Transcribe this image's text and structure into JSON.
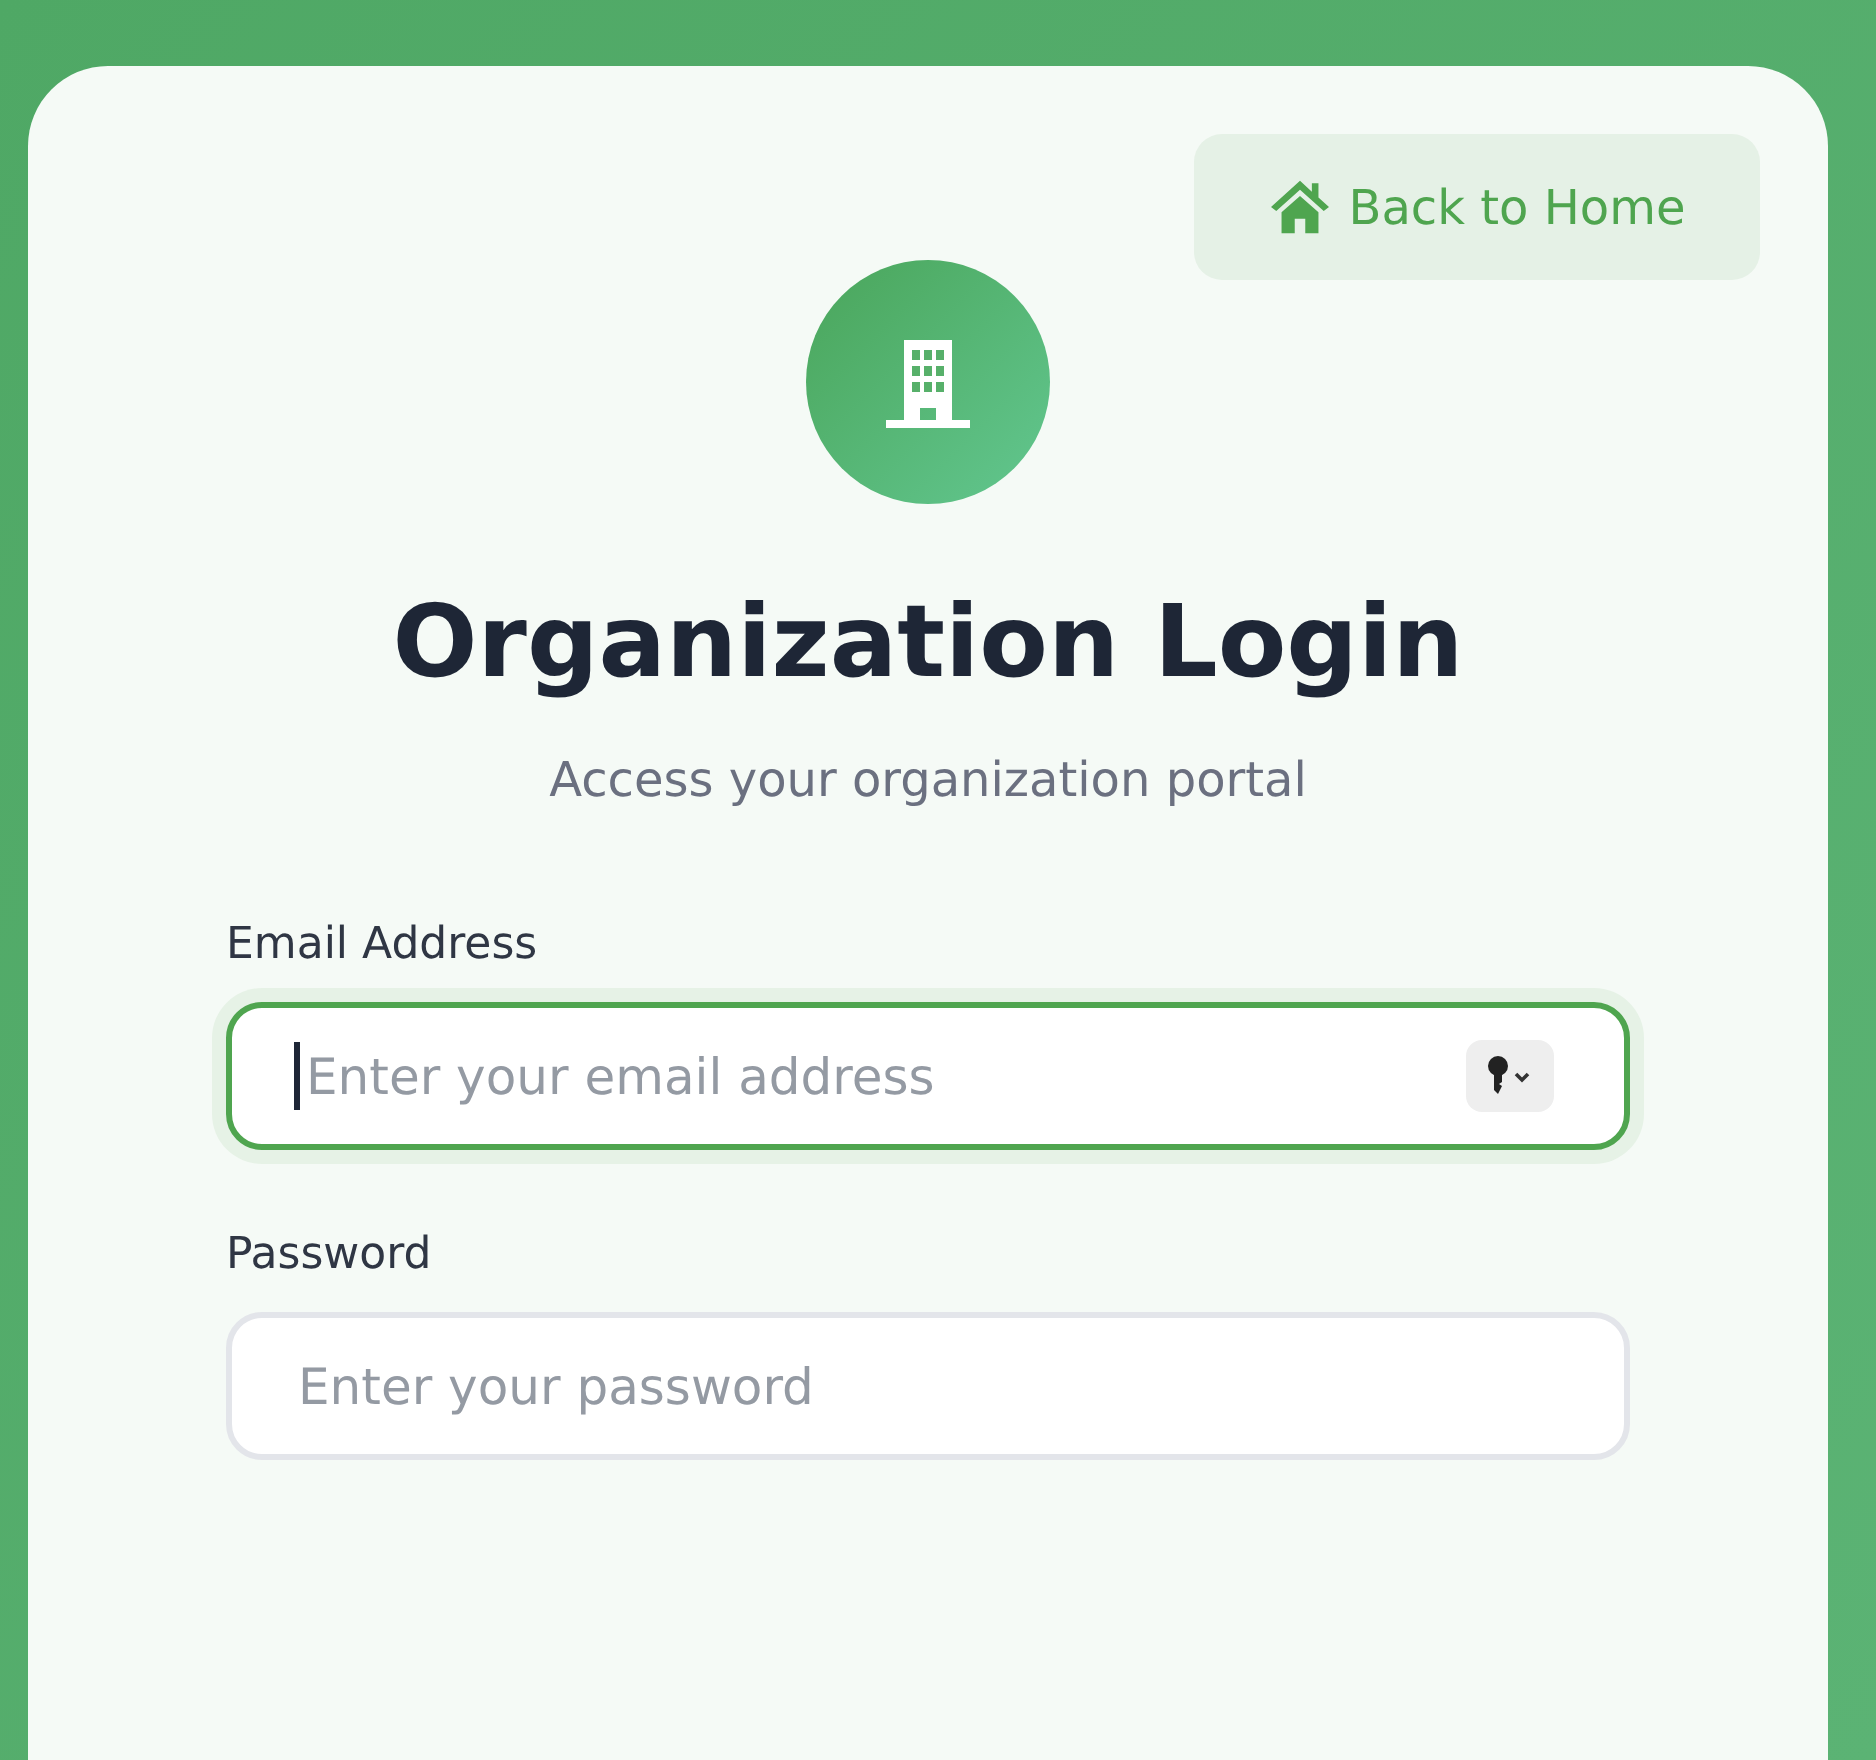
{
  "back_button": {
    "label": "Back to Home"
  },
  "title": "Organization Login",
  "subtitle": "Access your organization portal",
  "fields": [
    {
      "label": "Email Address",
      "placeholder": "Enter your email address",
      "focused": true,
      "autofill_button": true
    },
    {
      "label": "Password",
      "placeholder": "Enter your password",
      "focused": false,
      "autofill_button": false
    }
  ]
}
